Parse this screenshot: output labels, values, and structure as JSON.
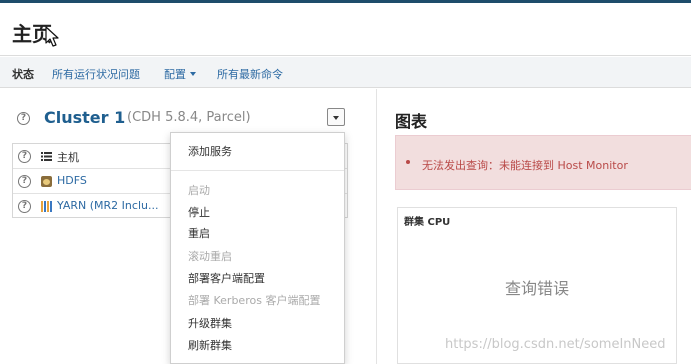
{
  "header": {
    "title": "主页"
  },
  "subnav": {
    "items": [
      {
        "label": "状态"
      },
      {
        "label": "所有运行状况问题"
      },
      {
        "label": "配置"
      },
      {
        "label": "所有最新命令"
      }
    ]
  },
  "cluster": {
    "name": "Cluster 1",
    "meta": "(CDH 5.8.4, Parcel)",
    "services": [
      {
        "label": "主机",
        "icon": "list-icon"
      },
      {
        "label": "HDFS",
        "icon": "hdfs-icon"
      },
      {
        "label": "YARN (MR2 Inclu...",
        "icon": "yarn-icon"
      }
    ]
  },
  "menu": {
    "items": [
      {
        "label": "添加服务",
        "disabled": false
      },
      {
        "label": "启动",
        "disabled": true
      },
      {
        "label": "停止",
        "disabled": false
      },
      {
        "label": "重启",
        "disabled": false
      },
      {
        "label": "滚动重启",
        "disabled": true
      },
      {
        "label": "部署客户端配置",
        "disabled": false
      },
      {
        "label": "部署 Kerberos 客户端配置",
        "disabled": true
      },
      {
        "label": "升级群集",
        "disabled": false
      },
      {
        "label": "刷新群集",
        "disabled": false
      }
    ]
  },
  "charts": {
    "title": "图表",
    "alert": "无法发出查询：未能连接到 Host Monitor",
    "cpu": {
      "title": "群集 CPU",
      "error": "查询错误"
    }
  },
  "watermark": "https://blog.csdn.net/someInNeed",
  "colors": {
    "topbar": "#1e4d6b",
    "link": "#2d6aa3",
    "alert_bg": "#f2dede",
    "alert_text": "#b94a48"
  }
}
